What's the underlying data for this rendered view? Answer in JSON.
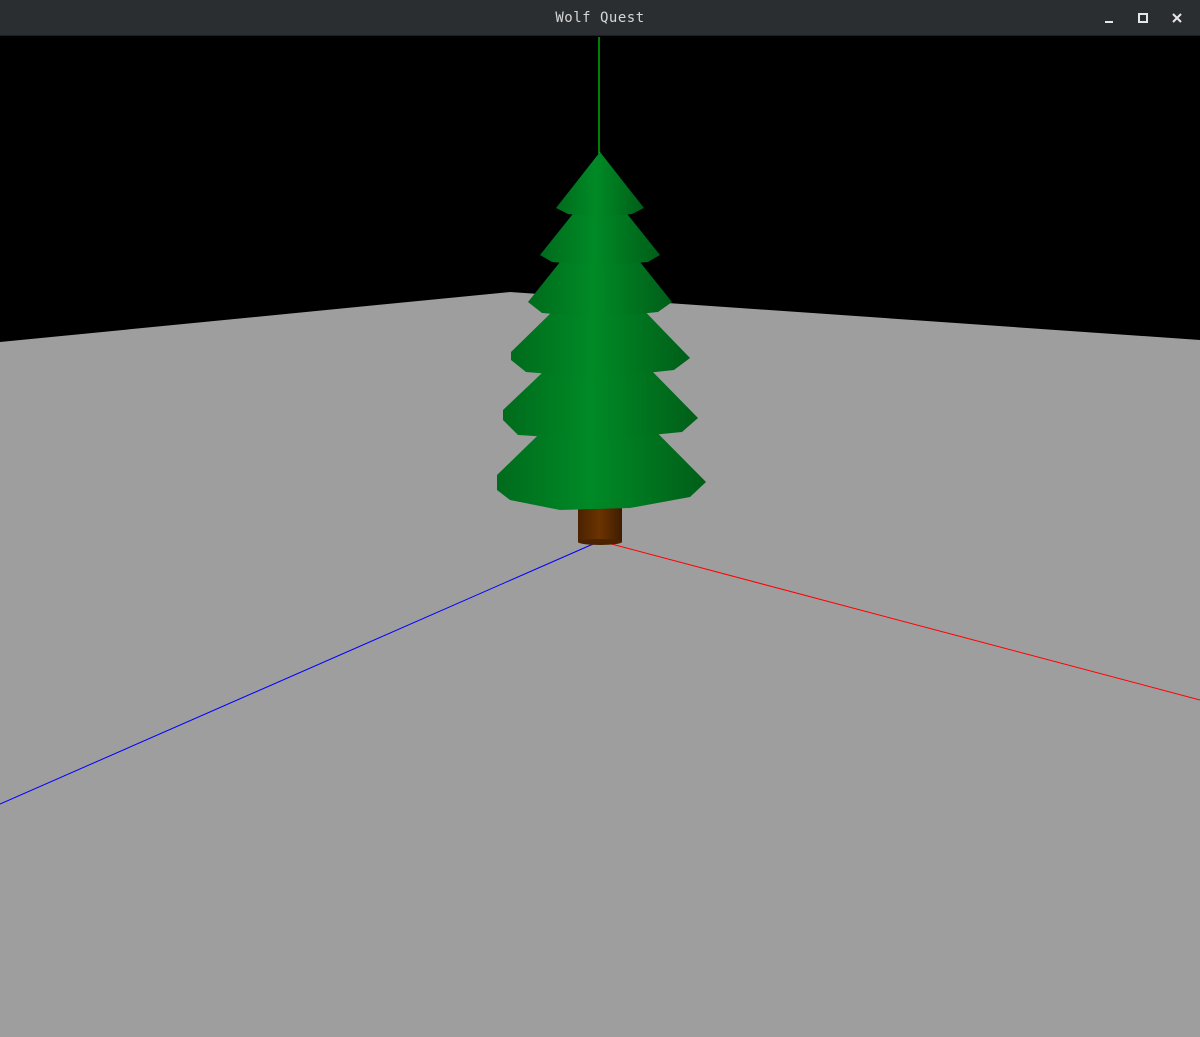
{
  "window": {
    "title": "Wolf Quest"
  },
  "controls": {
    "minimize_icon": "minimize-icon",
    "maximize_icon": "maximize-icon",
    "close_icon": "close-icon"
  },
  "scene": {
    "background_color": "#000000",
    "ground_color": "#9e9e9e",
    "tree_foliage_color": "#007a20",
    "tree_trunk_color": "#5a2a00",
    "axis_colors": {
      "x": "#ff0000",
      "y": "#00ff00",
      "z": "#0000ff"
    }
  }
}
